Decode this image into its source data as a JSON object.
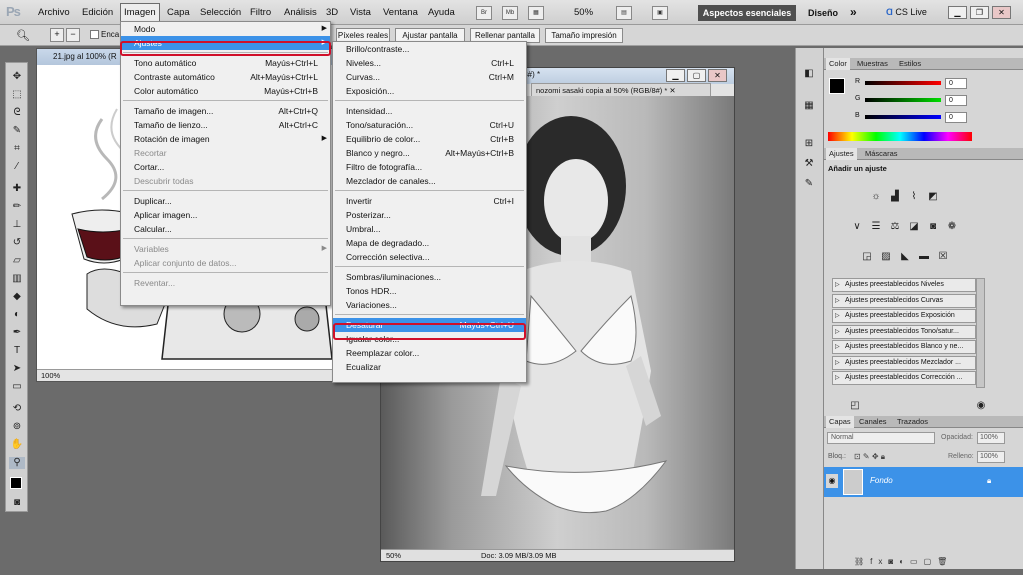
{
  "app": {
    "logo": "Ps"
  },
  "menubar": [
    "Archivo",
    "Edición",
    "Imagen",
    "Capa",
    "Selección",
    "Filtro",
    "Análisis",
    "3D",
    "Vista",
    "Ventana",
    "Ayuda"
  ],
  "topbar": {
    "br": "Br",
    "mb": "Mb",
    "zoom": "50%",
    "workspace": "Aspectos esenciales",
    "design": "Diseño",
    "chevron": "»",
    "cslive": "CS Live"
  },
  "options": {
    "encajar": "Enca",
    "buttons": [
      "Píxeles reales",
      "Ajustar pantalla",
      "Rellenar pantalla",
      "Tamaño impresión"
    ]
  },
  "doc1": {
    "title": "21.jpg al 100% (R",
    "zoom": "100%"
  },
  "doc2": {
    "tab": "nozomi sasaki copia al 50% (RGB/8#) *",
    "behind": "/8#) *",
    "zoom": "50%",
    "docsize": "Doc: 3.09 MB/3.09 MB"
  },
  "image_menu": [
    {
      "label": "Modo",
      "shortcut": "",
      "submenu": true,
      "disabled": false
    },
    {
      "label": "Ajustes",
      "shortcut": "",
      "submenu": true,
      "disabled": false,
      "highlight": true
    },
    {
      "label": "Tono automático",
      "shortcut": "Mayús+Ctrl+L"
    },
    {
      "label": "Contraste automático",
      "shortcut": "Alt+Mayús+Ctrl+L"
    },
    {
      "label": "Color automático",
      "shortcut": "Mayús+Ctrl+B"
    },
    {
      "label": "Tamaño de imagen...",
      "shortcut": "Alt+Ctrl+Q"
    },
    {
      "label": "Tamaño de lienzo...",
      "shortcut": "Alt+Ctrl+C"
    },
    {
      "label": "Rotación de imagen",
      "shortcut": "",
      "submenu": true
    },
    {
      "label": "Recortar",
      "shortcut": "",
      "disabled": true
    },
    {
      "label": "Cortar...",
      "shortcut": ""
    },
    {
      "label": "Descubrir todas",
      "shortcut": "",
      "disabled": true
    },
    {
      "label": "Duplicar...",
      "shortcut": ""
    },
    {
      "label": "Aplicar imagen...",
      "shortcut": ""
    },
    {
      "label": "Calcular...",
      "shortcut": ""
    },
    {
      "label": "Variables",
      "shortcut": "",
      "submenu": true,
      "disabled": true
    },
    {
      "label": "Aplicar conjunto de datos...",
      "shortcut": "",
      "disabled": true
    },
    {
      "label": "Reventar...",
      "shortcut": "",
      "disabled": true
    }
  ],
  "ajustes_menu": [
    {
      "label": "Brillo/contraste...",
      "shortcut": ""
    },
    {
      "label": "Niveles...",
      "shortcut": "Ctrl+L"
    },
    {
      "label": "Curvas...",
      "shortcut": "Ctrl+M"
    },
    {
      "label": "Exposición...",
      "shortcut": ""
    },
    {
      "label": "Intensidad...",
      "shortcut": ""
    },
    {
      "label": "Tono/saturación...",
      "shortcut": "Ctrl+U"
    },
    {
      "label": "Equilibrio de color...",
      "shortcut": "Ctrl+B"
    },
    {
      "label": "Blanco y negro...",
      "shortcut": "Alt+Mayús+Ctrl+B"
    },
    {
      "label": "Filtro de fotografía...",
      "shortcut": ""
    },
    {
      "label": "Mezclador de canales...",
      "shortcut": ""
    },
    {
      "label": "Invertir",
      "shortcut": "Ctrl+I"
    },
    {
      "label": "Posterizar...",
      "shortcut": ""
    },
    {
      "label": "Umbral...",
      "shortcut": ""
    },
    {
      "label": "Mapa de degradado...",
      "shortcut": ""
    },
    {
      "label": "Corrección selectiva...",
      "shortcut": ""
    },
    {
      "label": "Sombras/iluminaciones...",
      "shortcut": ""
    },
    {
      "label": "Tonos HDR...",
      "shortcut": ""
    },
    {
      "label": "Variaciones...",
      "shortcut": ""
    },
    {
      "label": "Desaturar",
      "shortcut": "Mayús+Ctrl+U",
      "highlight": true
    },
    {
      "label": "Igualar color...",
      "shortcut": ""
    },
    {
      "label": "Reemplazar color...",
      "shortcut": ""
    },
    {
      "label": "Ecualizar",
      "shortcut": ""
    }
  ],
  "color_panel": {
    "tabs": [
      "Color",
      "Muestras",
      "Estilos"
    ],
    "channels": [
      {
        "name": "R",
        "value": "0"
      },
      {
        "name": "G",
        "value": "0"
      },
      {
        "name": "B",
        "value": "0"
      }
    ]
  },
  "adjust_panel": {
    "tabs": [
      "Ajustes",
      "Máscaras"
    ],
    "heading": "Añadir un ajuste",
    "presets": [
      "Ajustes preestablecidos Niveles",
      "Ajustes preestablecidos Curvas",
      "Ajustes preestablecidos Exposición",
      "Ajustes preestablecidos Tono/satur...",
      "Ajustes preestablecidos Blanco y ne...",
      "Ajustes preestablecidos Mezclador ...",
      "Ajustes preestablecidos Corrección ..."
    ]
  },
  "layers_panel": {
    "tabs": [
      "Capas",
      "Canales",
      "Trazados"
    ],
    "blend": "Normal",
    "opacity_label": "Opacidad:",
    "opacity": "100%",
    "lock_label": "Bloq.:",
    "fill_label": "Relleno:",
    "fill": "100%",
    "layer_name": "Fondo"
  },
  "colors": {
    "highlight": "#3c92e8",
    "red_outline": "#d0102a",
    "layer_selected": "#3c92e8"
  }
}
